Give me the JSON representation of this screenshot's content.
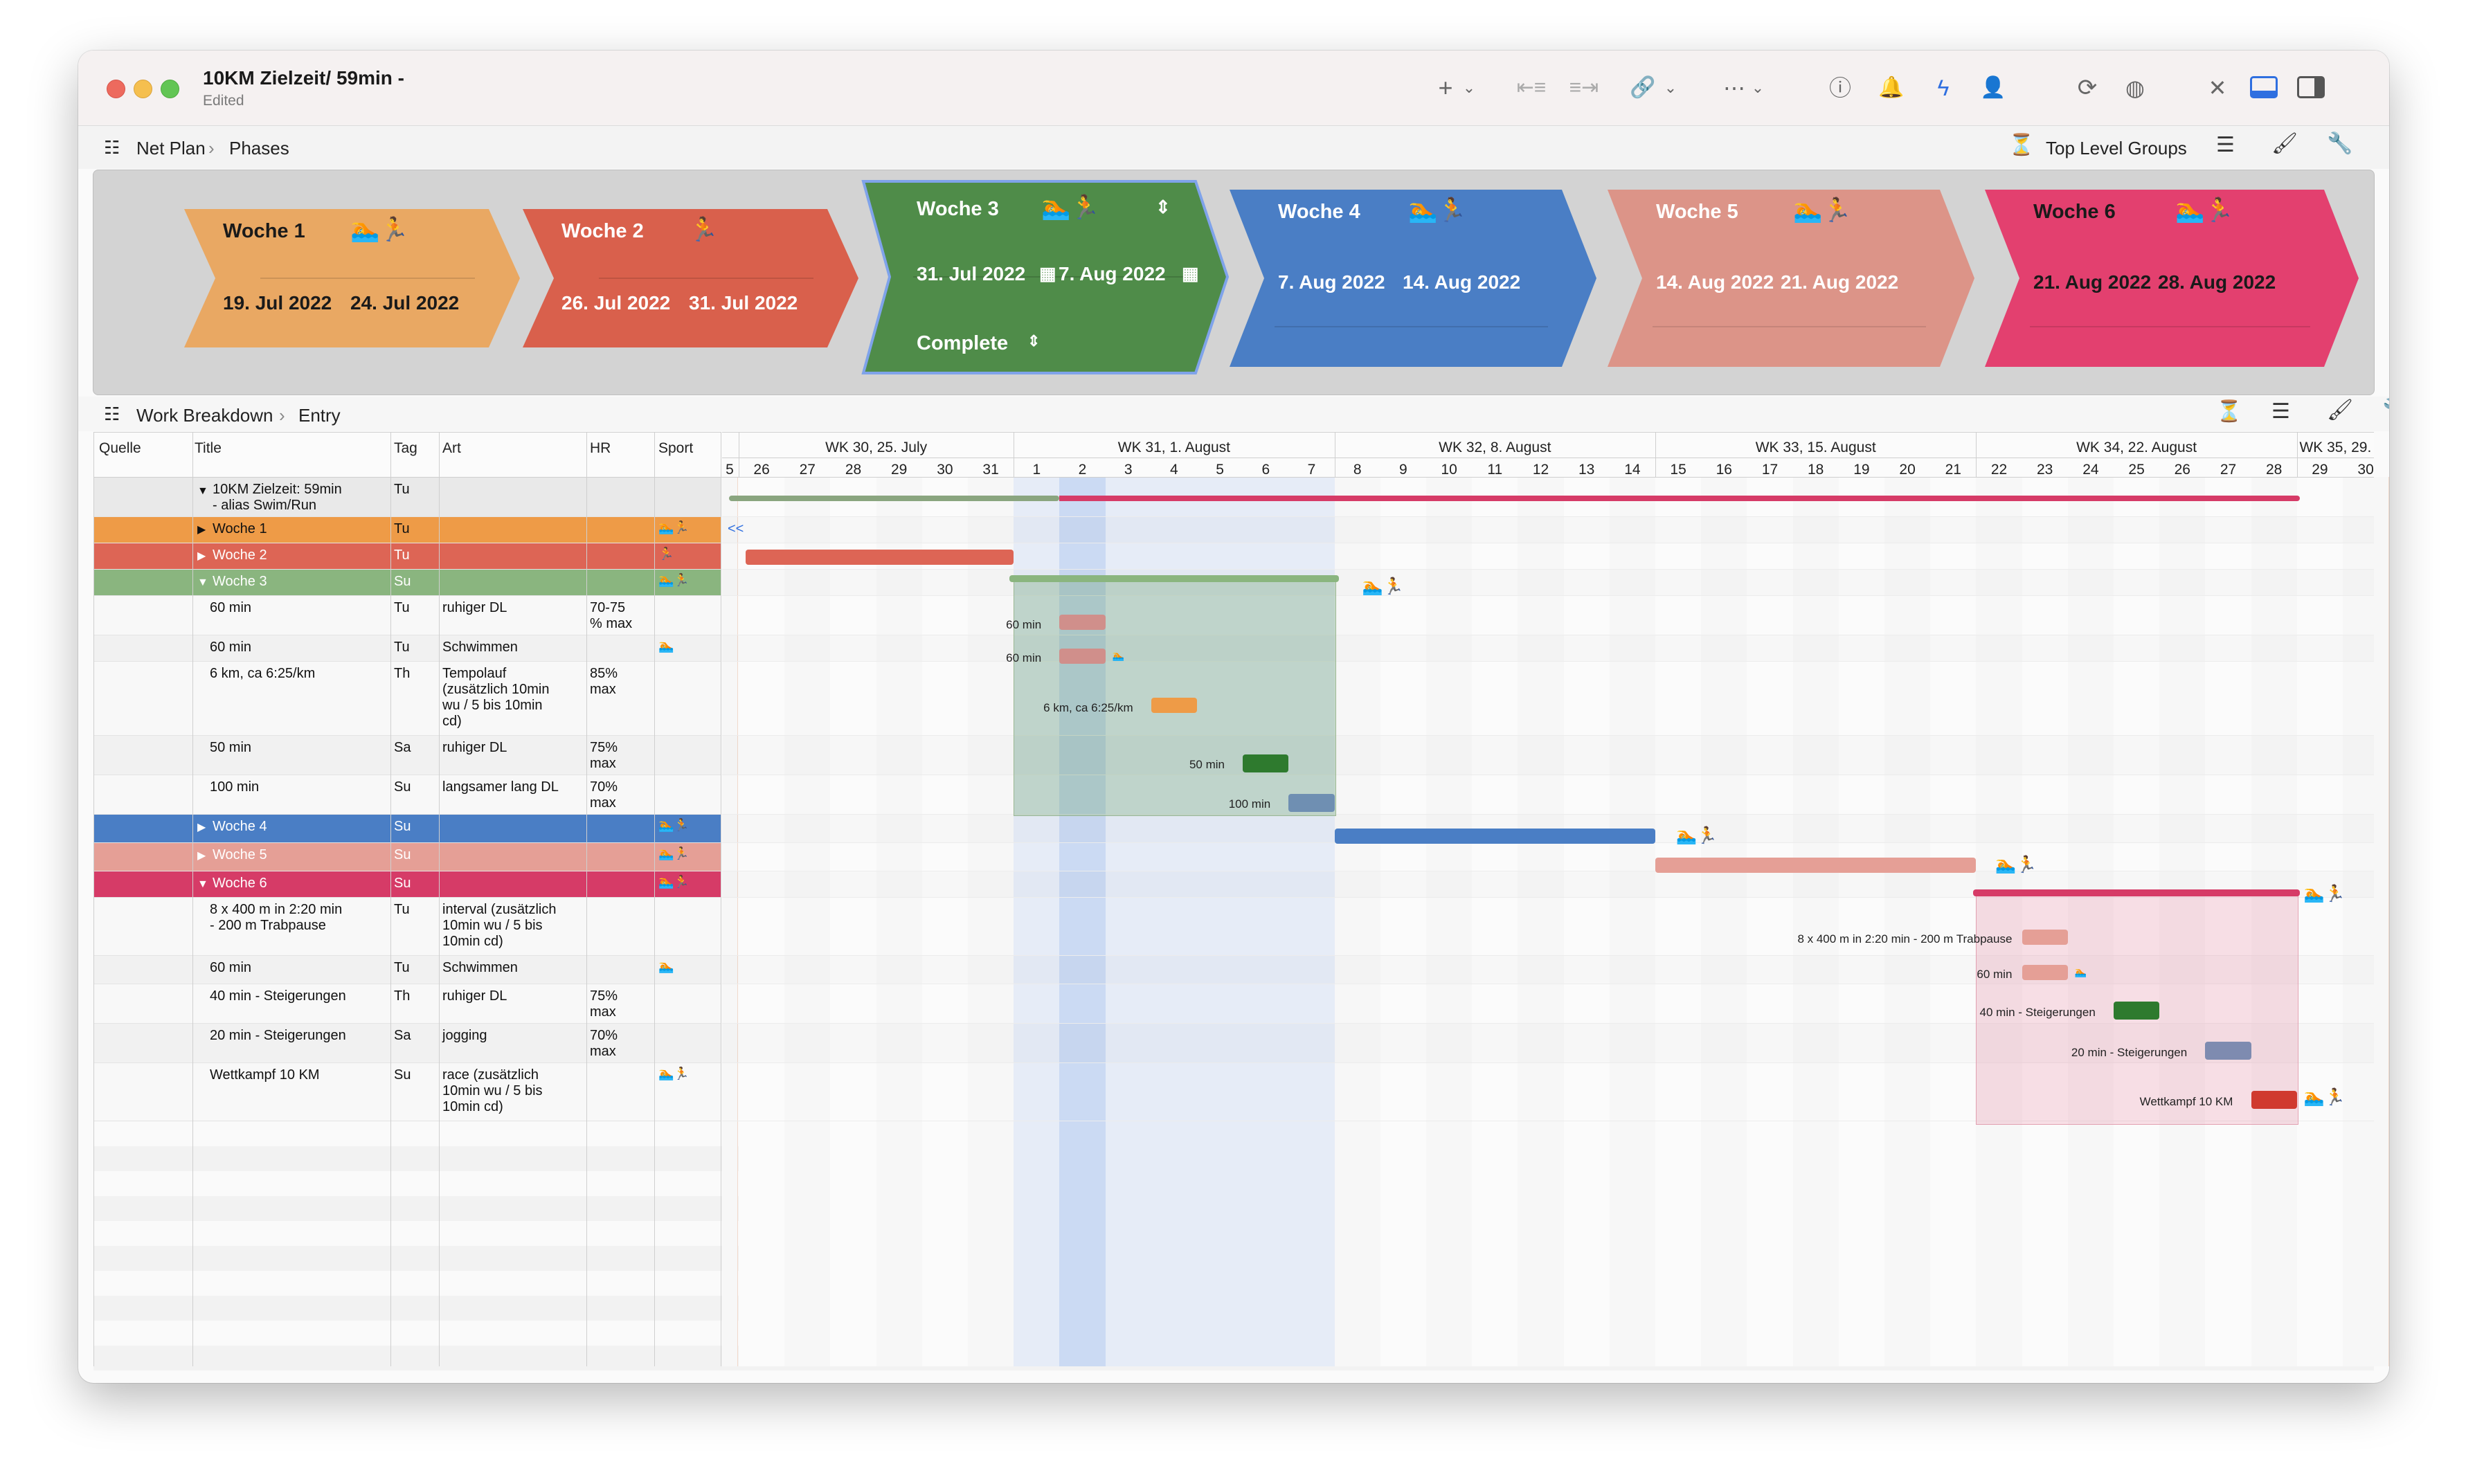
{
  "window": {
    "title": "10KM Zielzeit/ 59min -",
    "subtitle": "Edited"
  },
  "toolbar": {
    "icons": [
      "plus-icon",
      "outdent-icon",
      "indent-icon",
      "link-icon",
      "more-icon",
      "help-icon",
      "bell-icon",
      "bolt-icon",
      "person-icon",
      "refresh-icon",
      "globe-icon",
      "tools-icon",
      "layout-icon",
      "sidebar-icon"
    ]
  },
  "netplan": {
    "title": "Net Plan",
    "crumb": "Phases",
    "filter_label": "Top Level Groups"
  },
  "phases": [
    {
      "name": "Woche 1",
      "start": "19. Jul 2022",
      "end": "24. Jul 2022",
      "color": "#e9a863"
    },
    {
      "name": "Woche 2",
      "start": "26. Jul 2022",
      "end": "31. Jul 2022",
      "color": "#d9604c"
    },
    {
      "name": "Woche 3",
      "start": "31. Jul 2022",
      "end": "7. Aug 2022",
      "status": "Complete",
      "color": "#4f8c49"
    },
    {
      "name": "Woche 4",
      "start": "7. Aug 2022",
      "end": "14. Aug 2022",
      "color": "#4a7ec5"
    },
    {
      "name": "Woche 5",
      "start": "14. Aug 2022",
      "end": "21. Aug 2022",
      "color": "#dc9488"
    },
    {
      "name": "Woche 6",
      "start": "21. Aug 2022",
      "end": "28. Aug 2022",
      "color": "#e3406f"
    }
  ],
  "sport_icons": {
    "swim": "🏊",
    "run": "🏃"
  },
  "wbs": {
    "title": "Work Breakdown",
    "crumb": "Entry"
  },
  "columns": {
    "quelle": "Quelle",
    "title": "Title",
    "tag": "Tag",
    "art": "Art",
    "hr": "HR",
    "sport": "Sport"
  },
  "rows": [
    {
      "title": "10KM Zielzeit: 59min",
      "title2": "- alias Swim/Run",
      "tag": "Tu",
      "art": "",
      "hr": "",
      "sport": ""
    },
    {
      "title": "Woche 1",
      "tag": "Tu",
      "sport": "🏊🏃"
    },
    {
      "title": "Woche 2",
      "tag": "Tu",
      "sport": "🏃"
    },
    {
      "title": "Woche 3",
      "tag": "Su",
      "sport": "🏊🏃"
    },
    {
      "title": "60 min",
      "tag": "Tu",
      "art": "ruhiger DL",
      "hr": "70-75\n% max",
      "sport": ""
    },
    {
      "title": "60 min",
      "tag": "Tu",
      "art": "Schwimmen",
      "hr": "",
      "sport": "🏊"
    },
    {
      "title": "6 km, ca 6:25/km",
      "tag": "Th",
      "art": "Tempolauf\n(zusätzlich 10min\nwu / 5 bis 10min\ncd)",
      "hr": "85%\nmax",
      "sport": ""
    },
    {
      "title": "50 min",
      "tag": "Sa",
      "art": "ruhiger DL",
      "hr": "75%\nmax",
      "sport": ""
    },
    {
      "title": "100 min",
      "tag": "Su",
      "art": "langsamer lang DL",
      "hr": "70%\nmax",
      "sport": ""
    },
    {
      "title": "Woche 4",
      "tag": "Su",
      "sport": "🏊🏃"
    },
    {
      "title": "Woche 5",
      "tag": "Su",
      "sport": "🏊🏃"
    },
    {
      "title": "Woche 6",
      "tag": "Su",
      "sport": "🏊🏃"
    },
    {
      "title": "8 x 400 m in 2:20 min\n- 200 m Trabpause",
      "tag": "Tu",
      "art": "interval (zusätzlich\n10min wu / 5 bis\n10min cd)",
      "hr": "",
      "sport": ""
    },
    {
      "title": "60 min",
      "tag": "Tu",
      "art": "Schwimmen",
      "hr": "",
      "sport": "🏊"
    },
    {
      "title": "40 min - Steigerungen",
      "tag": "Th",
      "art": "ruhiger DL",
      "hr": "75%\nmax",
      "sport": ""
    },
    {
      "title": "20 min - Steigerungen",
      "tag": "Sa",
      "art": "jogging",
      "hr": "70%\nmax",
      "sport": ""
    },
    {
      "title": "Wettkampf 10 KM",
      "tag": "Su",
      "art": "race (zusätzlich\n10min wu / 5 bis\n10min cd)",
      "hr": "",
      "sport": "🏊🏃"
    }
  ],
  "gantt": {
    "weeks": [
      "WK 30, 25. July",
      "WK 31, 1. August",
      "WK 32, 8. August",
      "WK 33, 15. August",
      "WK 34, 22. August",
      "WK 35, 29."
    ],
    "days": [
      "5",
      "26",
      "27",
      "28",
      "29",
      "30",
      "31",
      "1",
      "2",
      "3",
      "4",
      "5",
      "6",
      "7",
      "8",
      "9",
      "10",
      "11",
      "12",
      "13",
      "14",
      "15",
      "16",
      "17",
      "18",
      "19",
      "20",
      "21",
      "22",
      "23",
      "24",
      "25",
      "26",
      "27",
      "28",
      "29",
      "30"
    ],
    "collapse_marker": "<<",
    "labels": {
      "w3a": "60 min",
      "w3b": "60 min",
      "w3c": "6 km, ca 6:25/km",
      "w3d": "50 min",
      "w3e": "100 min",
      "w6a": "8 x 400 m in 2:20 min - 200 m Trabpause",
      "w6b": "60 min",
      "w6c": "40 min - Steigerungen",
      "w6d": "20 min - Steigerungen",
      "w6e": "Wettkampf 10 KM"
    }
  }
}
